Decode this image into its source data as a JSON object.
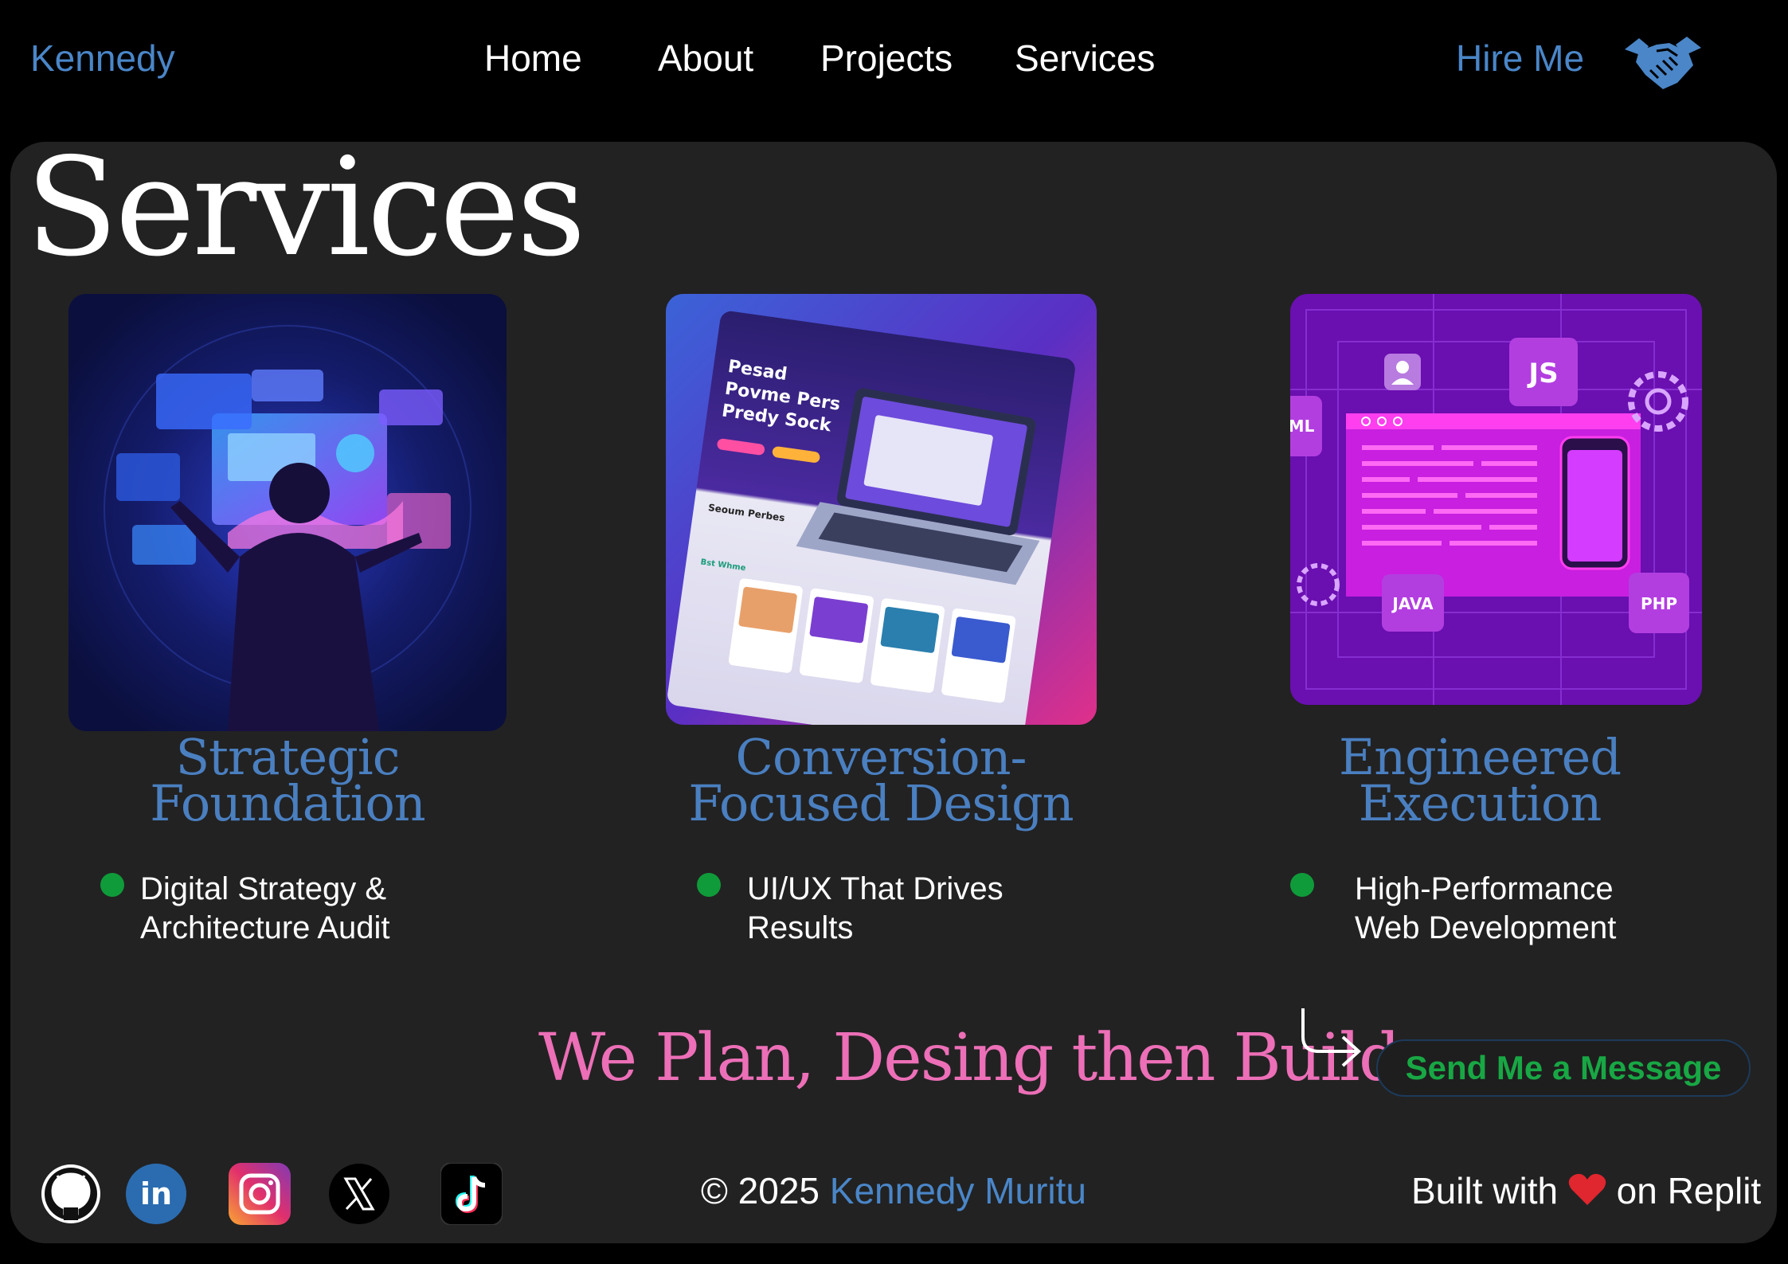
{
  "nav": {
    "brand": "Kennedy",
    "links": [
      "Home",
      "About",
      "Projects",
      "Services"
    ],
    "hire": "Hire Me",
    "hire_icon": "handshake-icon"
  },
  "page": {
    "title": "Services"
  },
  "cards": [
    {
      "title_lines": [
        "Strategic",
        "Foundation"
      ],
      "bullet_lines": [
        "Digital Strategy &",
        "Architecture Audit"
      ],
      "image": "person-with-holographic-dashboards-illustration"
    },
    {
      "title_lines": [
        "Conversion-",
        "Focused Design"
      ],
      "bullet_lines": [
        "UI/UX That Drives",
        "Results"
      ],
      "image": "laptop-website-mockup-illustration"
    },
    {
      "title_lines": [
        "Engineered",
        "Execution"
      ],
      "bullet_lines": [
        "High-Performance",
        "Web Development"
      ],
      "image": "code-window-phone-tech-badges-illustration",
      "badges": [
        "ML",
        "JS",
        "JAVA",
        "PHP"
      ]
    }
  ],
  "illustration_text": {
    "mockup_heading": [
      "Pesad",
      "Povme Pers",
      "Predy Sock"
    ],
    "mockup_section": "Seoum Perbes",
    "mockup_sub": "Bst Whme"
  },
  "tagline": "We Plan, Desing then Build",
  "cta": {
    "label": "Send Me a Message"
  },
  "footer": {
    "copyright_prefix": "© 2025 ",
    "copyright_name": "Kennedy Muritu",
    "built_prefix": "Built with ",
    "built_suffix": " on Replit",
    "social_icons": [
      "github-icon",
      "linkedin-icon",
      "instagram-icon",
      "x-icon",
      "tiktok-icon"
    ]
  },
  "colors": {
    "accent_blue": "#4a86c8",
    "tagline_pink": "#ec6fb7",
    "cta_green": "#18a744",
    "bullet_green": "#0f9b3a",
    "panel": "#222222"
  }
}
